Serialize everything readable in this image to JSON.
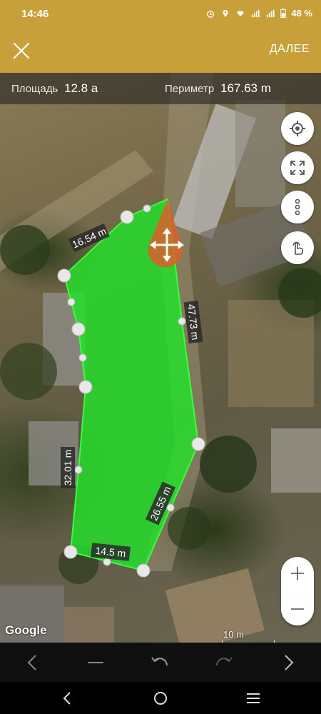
{
  "status_bar": {
    "time": "14:46",
    "battery": "48 %",
    "icons": [
      "alarm-icon",
      "location-icon",
      "wifi-icon",
      "signal-icon",
      "signal-icon",
      "battery-icon"
    ]
  },
  "app_bar": {
    "close_icon": "close-icon",
    "next_label": "ДАЛЕЕ"
  },
  "measurements": {
    "area_label": "Площадь",
    "area_value": "12.8 а",
    "perimeter_label": "Периметр",
    "perimeter_value": "167.63 m"
  },
  "polygon": {
    "fill_color": "#22e22a",
    "edge_labels": [
      "16.54 m",
      "47.73 m",
      "26.55 m",
      "14.5 m",
      "32.01 m"
    ]
  },
  "map_buttons": [
    "my-location-icon",
    "fullscreen-icon",
    "more-vert-icon",
    "touch-mode-icon"
  ],
  "zoom": {
    "in_icon": "plus-icon",
    "out_icon": "minus-icon"
  },
  "map": {
    "attribution": "Google",
    "scale": "10 m"
  },
  "toolbar": [
    "prev-icon",
    "delete-icon",
    "undo-icon",
    "redo-icon",
    "next-icon"
  ],
  "nav_bar": [
    "back-icon",
    "home-icon",
    "recents-icon"
  ]
}
